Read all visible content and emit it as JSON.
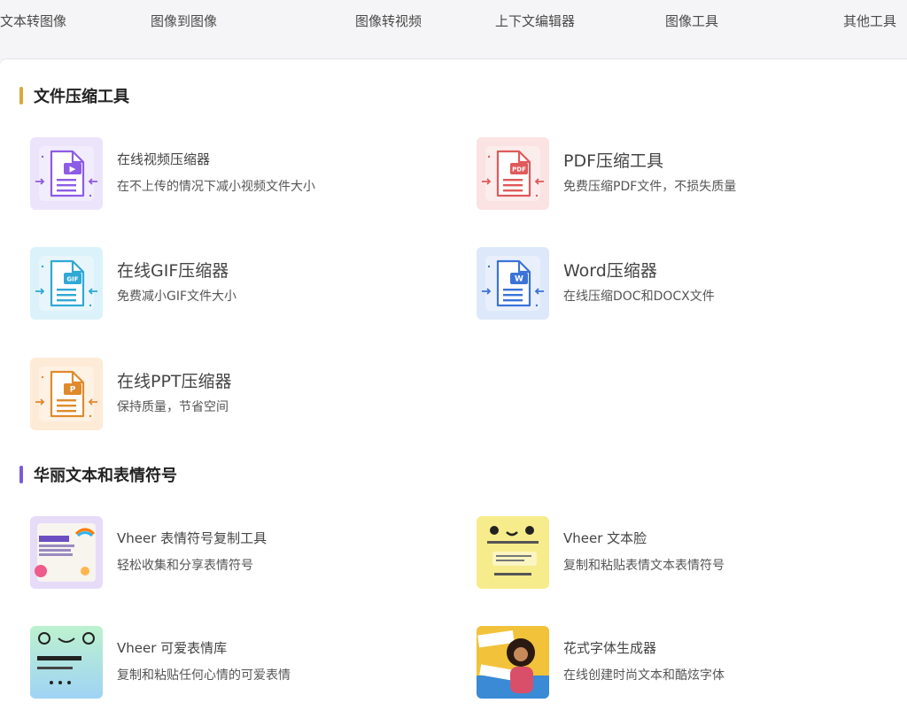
{
  "nav": {
    "tabs": [
      "文本转图像",
      "图像到图像",
      "图像转视频",
      "上下文编辑器",
      "图像工具",
      "其他工具"
    ]
  },
  "sections": [
    {
      "title": "文件压缩工具",
      "accent": "#d9a93a",
      "cards": [
        {
          "title": "在线视频压缩器",
          "desc": "在不上传的情况下减小视频文件大小",
          "icon": "video-file-icon",
          "bg": "#ece4fb",
          "color": "#8d5ce6",
          "badge": "▶"
        },
        {
          "title": "PDF压缩工具",
          "desc": "免费压缩PDF文件，不损失质量",
          "icon": "pdf-file-icon",
          "bg": "#fbe3e3",
          "color": "#e05a5a",
          "badge": "PDF"
        },
        {
          "title": "在线GIF压缩器",
          "desc": "免费减小GIF文件大小",
          "icon": "gif-file-icon",
          "bg": "#dcf2fb",
          "color": "#2fa9d6",
          "badge": "GIF"
        },
        {
          "title": "Word压缩器",
          "desc": "在线压缩DOC和DOCX文件",
          "icon": "word-file-icon",
          "bg": "#dde8fb",
          "color": "#3b73d9",
          "badge": "W"
        },
        {
          "title": "在线PPT压缩器",
          "desc": "保持质量，节省空间",
          "icon": "ppt-file-icon",
          "bg": "#fdebd7",
          "color": "#e08a2c",
          "badge": "P"
        }
      ]
    },
    {
      "title": "华丽文本和表情符号",
      "accent": "#7b5cd6",
      "cards": [
        {
          "title": "Vheer 表情符号复制工具",
          "desc": "轻松收集和分享表情符号",
          "icon": "emoji-copy-thumbnail-icon",
          "bg": "#e6dcf8",
          "color": "#8a6ad8"
        },
        {
          "title": "Vheer 文本脸",
          "desc": "复制和粘贴表情文本表情符号",
          "icon": "text-face-thumbnail-icon",
          "bg": "#f7ec8c",
          "color": "#333333"
        },
        {
          "title": "Vheer 可爱表情库",
          "desc": "复制和粘贴任何心情的可爱表情",
          "icon": "cute-emoticon-thumbnail-icon",
          "bg": "#bff0d6",
          "color": "#222222"
        },
        {
          "title": "花式字体生成器",
          "desc": "在线创建时尚文本和酷炫字体",
          "icon": "fancy-font-thumbnail-icon",
          "bg": "#f2c23a",
          "color": "#222222"
        }
      ]
    }
  ]
}
